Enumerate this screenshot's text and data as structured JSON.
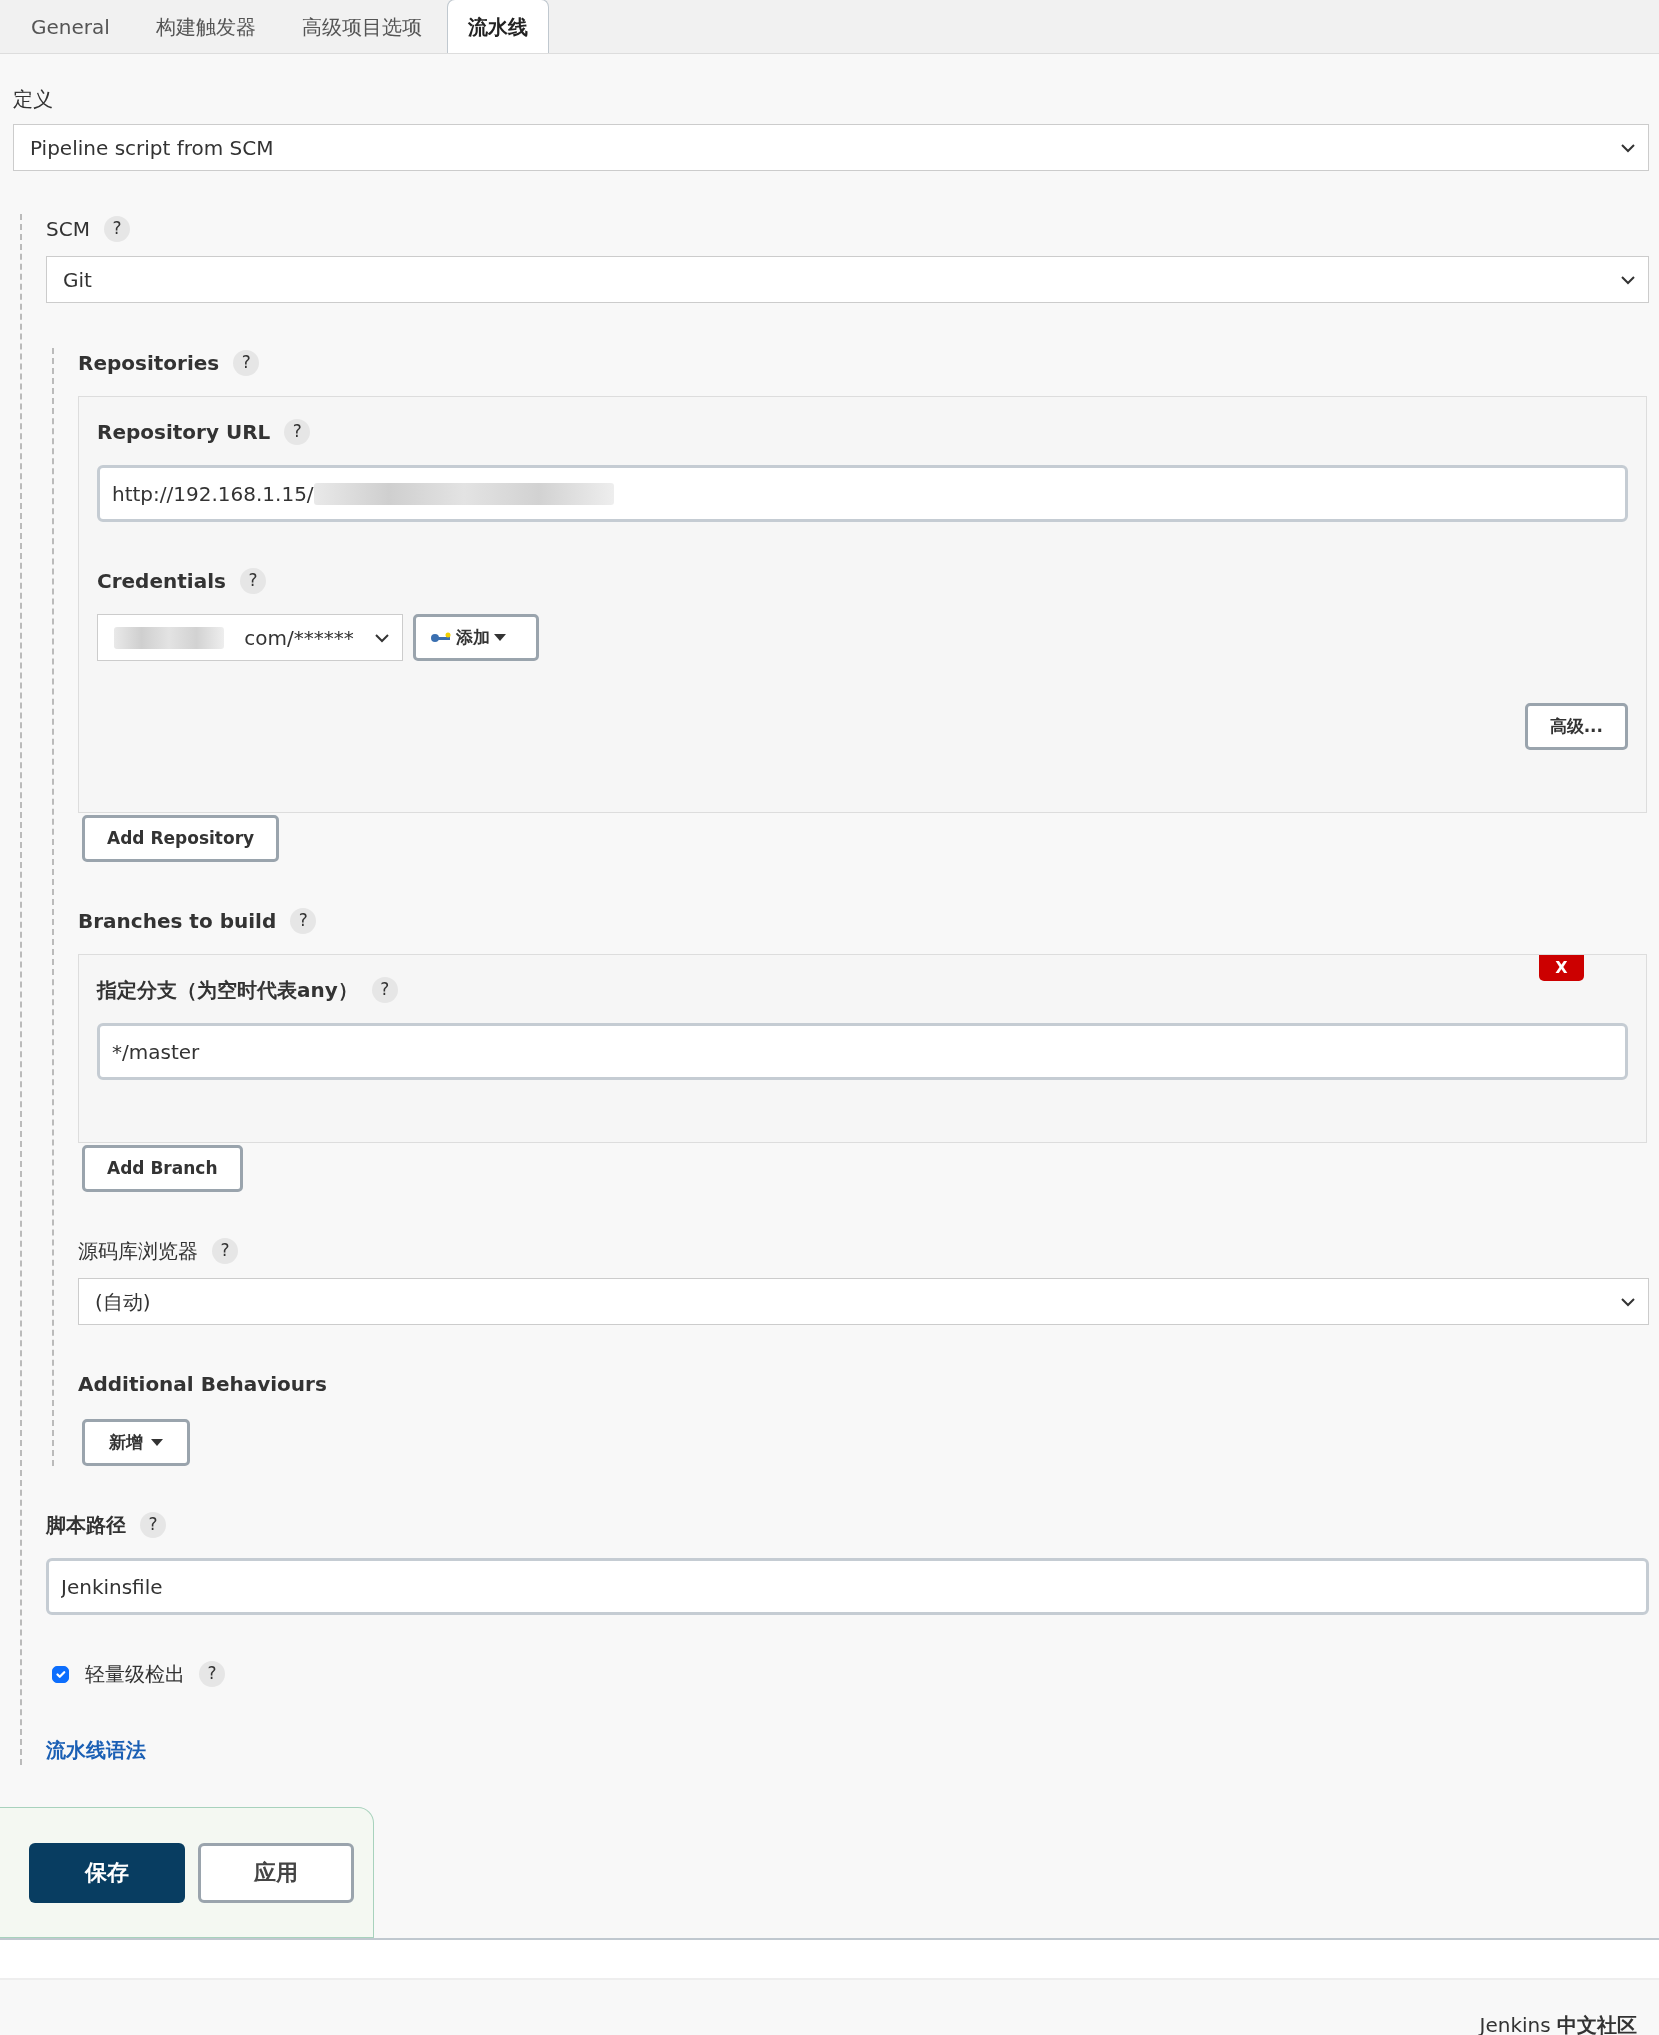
{
  "tabs": [
    {
      "label": "General",
      "selected": false
    },
    {
      "label": "构建触发器",
      "selected": false
    },
    {
      "label": "高级项目选项",
      "selected": false
    },
    {
      "label": "流水线",
      "selected": true
    }
  ],
  "definition": {
    "label": "定义",
    "value": "Pipeline script from SCM"
  },
  "scm": {
    "label": "SCM",
    "help": "?",
    "value": "Git",
    "repositories": {
      "label": "Repositories",
      "help": "?",
      "url_label": "Repository URL",
      "url_help": "?",
      "url_value": "http://192.168.1.15/",
      "credentials_label": "Credentials",
      "credentials_help": "?",
      "credentials_value": "com/******",
      "add_button": "添加",
      "advanced_button": "高级...",
      "add_repository_button": "Add Repository"
    },
    "branches": {
      "label": "Branches to build",
      "help": "?",
      "delete_button": "X",
      "branch_label": "指定分支（为空时代表any）",
      "branch_help": "?",
      "branch_value": "*/master",
      "add_branch_button": "Add Branch"
    },
    "browser": {
      "label": "源码库浏览器",
      "help": "?",
      "value": "(自动)"
    },
    "behaviours": {
      "label": "Additional Behaviours",
      "add_button": "新增"
    },
    "script_path": {
      "label": "脚本路径",
      "help": "?",
      "value": "Jenkinsfile"
    },
    "lightweight": {
      "label": "轻量级检出",
      "help": "?",
      "checked": true
    },
    "syntax_link": "流水线语法"
  },
  "buttons": {
    "save": "保存",
    "apply": "应用"
  },
  "footer": {
    "plain": "Jenkins",
    "bold": "中文社区"
  }
}
